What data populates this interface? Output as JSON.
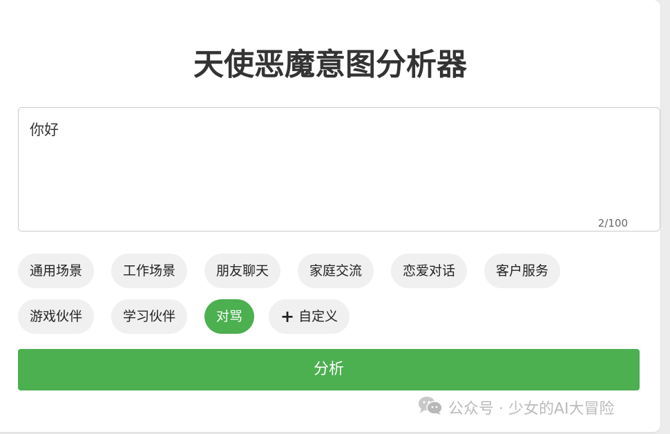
{
  "app": {
    "title": "天使恶魔意图分析器"
  },
  "input": {
    "value": "你好",
    "counter": "2/100"
  },
  "scenes": {
    "row1": [
      "通用场景",
      "工作场景",
      "朋友聊天",
      "家庭交流",
      "恋爱对话",
      "客户服务"
    ],
    "row2": [
      "游戏伙伴",
      "学习伙伴",
      "对骂"
    ],
    "selected": "对骂",
    "custom_label": "自定义",
    "custom_icon": "plus-icon"
  },
  "actions": {
    "analyze_label": "分析"
  },
  "watermark": {
    "text": "公众号 · 少女的AI大冒险",
    "icon": "wechat-icon"
  },
  "colors": {
    "accent": "#4caf50",
    "chip_bg": "#f0f0f0",
    "title": "#333333"
  }
}
